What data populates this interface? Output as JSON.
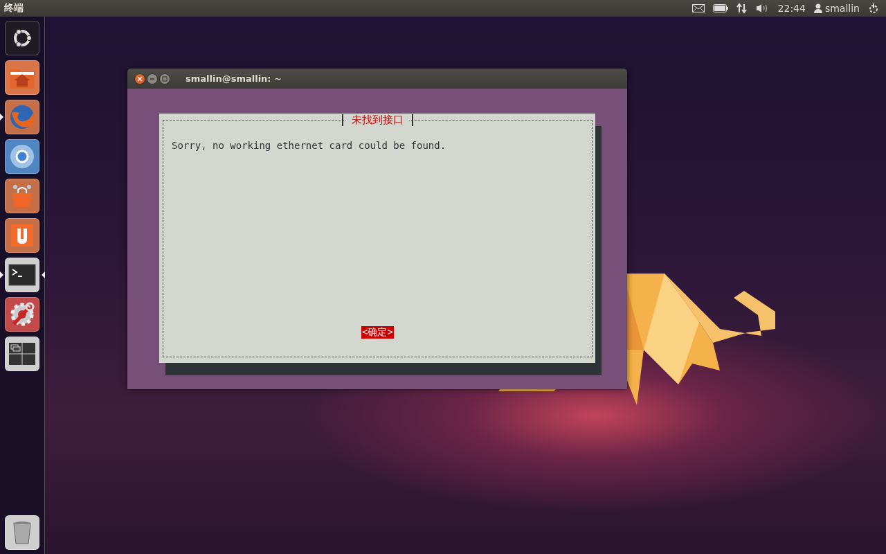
{
  "top_bar": {
    "app_title": "终端",
    "clock": "22:44",
    "user": "smallin"
  },
  "launcher": {
    "items": [
      {
        "kind": "dash",
        "running": false,
        "focused": false
      },
      {
        "kind": "files",
        "running": false,
        "focused": false
      },
      {
        "kind": "browser",
        "running": true,
        "focused": false
      },
      {
        "kind": "chromium",
        "running": false,
        "focused": false
      },
      {
        "kind": "store",
        "running": false,
        "focused": false
      },
      {
        "kind": "ubuntu-one",
        "running": false,
        "focused": false
      },
      {
        "kind": "terminal",
        "running": true,
        "focused": true
      },
      {
        "kind": "settings",
        "running": false,
        "focused": false
      },
      {
        "kind": "workspaces",
        "running": false,
        "focused": false
      },
      {
        "kind": "trash",
        "running": false,
        "focused": false
      }
    ]
  },
  "terminal": {
    "title": "smallin@smallin: ~",
    "dialog": {
      "title": "未找到接口",
      "message": "Sorry, no working ethernet card could be found.",
      "button": {
        "label": "<确定>",
        "selected": true
      }
    }
  }
}
